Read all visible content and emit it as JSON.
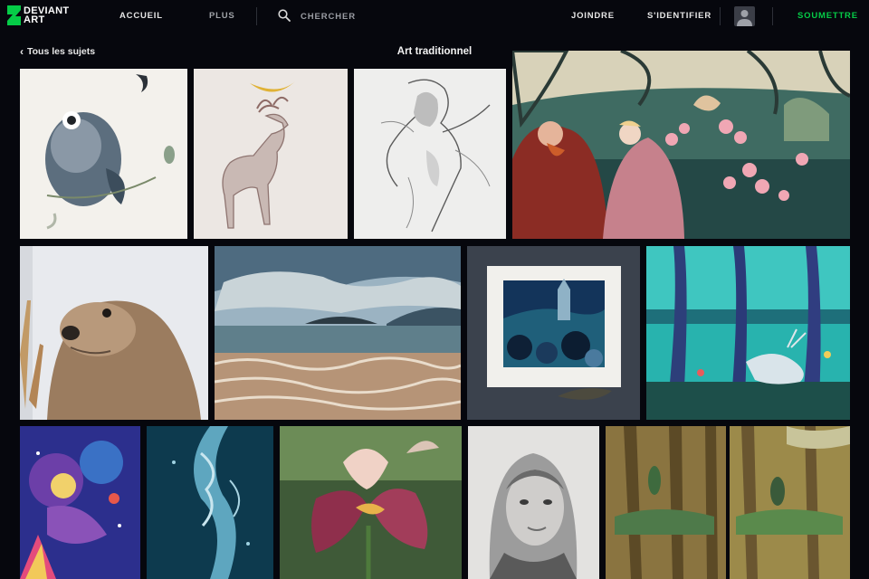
{
  "header": {
    "logo_text": "DEVIANT\nART",
    "nav": {
      "home": "ACCUEIL",
      "more": "PLUS",
      "join": "JOINDRE",
      "signin": "S'IDENTIFIER",
      "submit": "SOUMETTRE"
    },
    "search": {
      "placeholder": "CHERCHER"
    }
  },
  "subheader": {
    "back_label": "Tous les sujets",
    "title": "Art traditionnel"
  },
  "colors": {
    "accent": "#05cc47",
    "background": "#06070d"
  },
  "gallery": {
    "rows": [
      {
        "items": [
          "owl-watercolor",
          "deer-antler-moon",
          "pencil-figure-sketch",
          "two-figures-forest"
        ]
      },
      {
        "items": [
          "otter-pencil",
          "seascape-painting",
          "matted-castle-watercolor",
          "enchanted-forest-creature"
        ]
      },
      {
        "items": [
          "cosmic-owl-girl",
          "teal-wisp-figure",
          "iris-flower-watercolor",
          "woman-portrait-graphite",
          "forest-folk-diptych"
        ]
      }
    ]
  }
}
